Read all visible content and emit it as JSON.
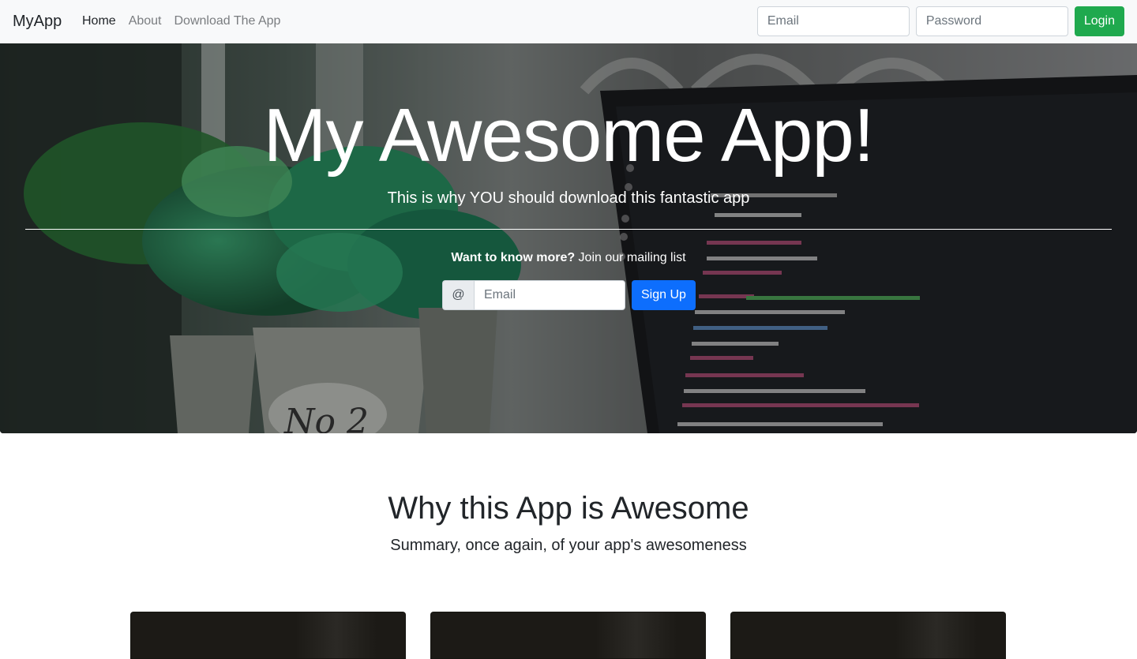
{
  "navbar": {
    "brand": "MyApp",
    "links": [
      {
        "label": "Home",
        "active": true
      },
      {
        "label": "About",
        "active": false
      },
      {
        "label": "Download The App",
        "active": false
      }
    ],
    "email_placeholder": "Email",
    "password_placeholder": "Password",
    "login_label": "Login"
  },
  "hero": {
    "title": "My Awesome App!",
    "subtitle": "This is why YOU should download this fantastic app",
    "cta_bold": "Want to know more?",
    "cta_rest": " Join our mailing list",
    "at_symbol": "@",
    "email_placeholder": "Email",
    "signup_label": "Sign Up"
  },
  "features": {
    "title": "Why this App is Awesome",
    "subtitle": "Summary, once again, of your app's awesomeness",
    "cards": [
      "card-1",
      "card-2",
      "card-3"
    ]
  },
  "colors": {
    "navbar_bg": "#f8f9fa",
    "login_button": "#1fa94e",
    "signup_button": "#0d6efd"
  }
}
